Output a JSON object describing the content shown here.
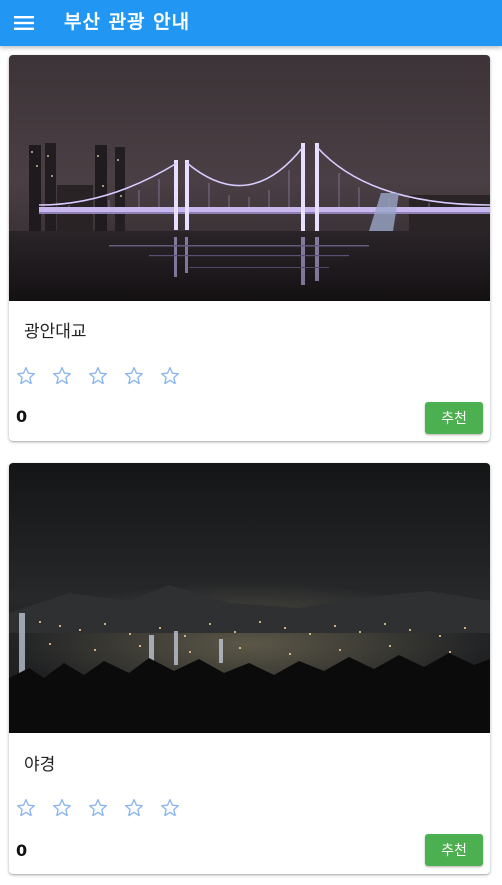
{
  "appbar": {
    "title": "부산 관광 안내",
    "menu_icon": "hamburger-menu-icon",
    "background": "#2196f3"
  },
  "cards": [
    {
      "title": "광안대교",
      "image_desc": "Gwangan Bridge illuminated at night over the sea",
      "rating_stars": 5,
      "rating_value": 0,
      "count": "0",
      "recommend_label": "추천"
    },
    {
      "title": "야경",
      "image_desc": "City night view of Busan from a mountain",
      "rating_stars": 5,
      "rating_value": 0,
      "count": "0",
      "recommend_label": "추천"
    }
  ],
  "colors": {
    "star": "#8ab4f0",
    "recommend_button": "#4caf50"
  }
}
